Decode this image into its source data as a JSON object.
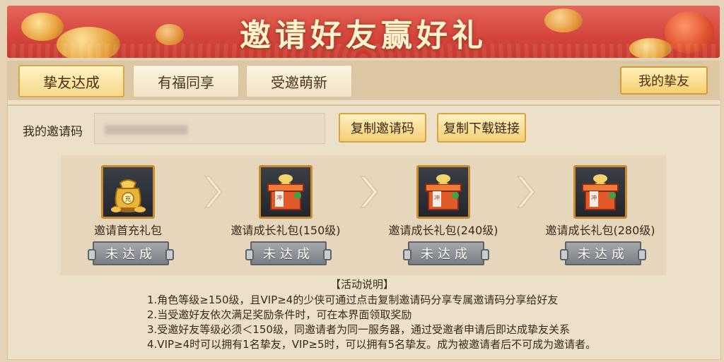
{
  "banner": {
    "title": "邀请好友赢好礼"
  },
  "tabs": [
    {
      "label": "挚友达成",
      "active": true
    },
    {
      "label": "有福同享",
      "active": false
    },
    {
      "label": "受邀萌新",
      "active": false
    }
  ],
  "friend_button": {
    "label": "我的挚友"
  },
  "invite": {
    "code_label": "我的邀请码",
    "copy_code_label": "复制邀请码",
    "copy_link_label": "复制下载链接"
  },
  "rewards": [
    {
      "name": "邀请首充礼包",
      "icon": "gold-money-bag-icon",
      "status": "未达成"
    },
    {
      "name": "邀请成长礼包(150级)",
      "icon": "gift-box-icon",
      "status": "未达成"
    },
    {
      "name": "邀请成长礼包(240级)",
      "icon": "gift-box-icon",
      "status": "未达成"
    },
    {
      "name": "邀请成长礼包(280级)",
      "icon": "gift-box-icon",
      "status": "未达成"
    }
  ],
  "notes": {
    "title": "【活动说明】",
    "lines": [
      "1.角色等级≥150级，且VIP≥4的少侠可通过点击复制邀请码分享专属邀请码分享给好友",
      "2.当受邀好友依次满足奖励条件时，可在本界面领取奖励",
      "3.受邀好友等级必须＜150级，同邀请者为同一服务器，通过受邀者申请后即达成挚友关系",
      "4.VIP≥4时可以拥有1名挚友，VIP≥5时，可以拥有5名挚友。成为被邀请者后不可成为邀请者。"
    ]
  },
  "colors": {
    "banner_red": "#d6473f",
    "gold": "#f5cf6e",
    "panel_bg": "#ece0c9",
    "disabled_gray": "#7a7f85"
  }
}
